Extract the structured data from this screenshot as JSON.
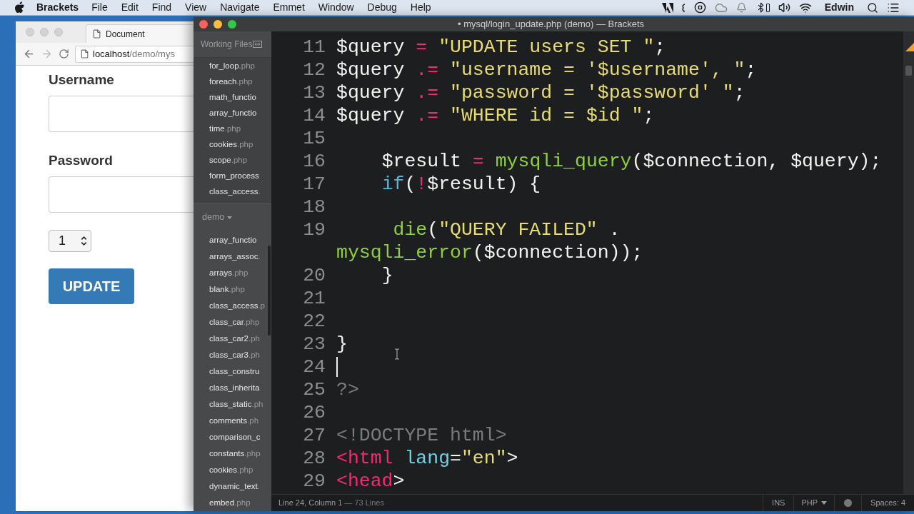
{
  "menubar": {
    "app": "Brackets",
    "menus": [
      "File",
      "Edit",
      "Find",
      "View",
      "Navigate",
      "Emmet",
      "Window",
      "Debug",
      "Help"
    ],
    "user": "Edwin"
  },
  "browser": {
    "tab": "Document",
    "url_host": "localhost",
    "url_path": "/demo/mys",
    "fields": [
      {
        "label": "Username"
      },
      {
        "label": "Password"
      }
    ],
    "select": "1",
    "button": "UPDATE"
  },
  "editor": {
    "title": "• mysql/login_update.php (demo) — Brackets",
    "working_files_title": "Working Files",
    "working_files": [
      {
        "name": "for_loop",
        "ext": ".php"
      },
      {
        "name": "foreach",
        "ext": ".php"
      },
      {
        "name": "math_functio"
      },
      {
        "name": "array_functio"
      },
      {
        "name": "time",
        "ext": ".php"
      },
      {
        "name": "cookies",
        "ext": ".php"
      },
      {
        "name": "scope",
        "ext": ".php"
      },
      {
        "name": "form_process"
      },
      {
        "name": "class_access",
        "ext": "."
      }
    ],
    "project": "demo",
    "project_files": [
      {
        "name": "array_functio"
      },
      {
        "name": "arrays_assoc",
        "ext": "."
      },
      {
        "name": "arrays",
        "ext": ".php"
      },
      {
        "name": "blank",
        "ext": ".php"
      },
      {
        "name": "class_access",
        "ext": ".p"
      },
      {
        "name": "class_car",
        "ext": ".php"
      },
      {
        "name": "class_car2",
        "ext": ".ph"
      },
      {
        "name": "class_car3",
        "ext": ".ph"
      },
      {
        "name": "class_constru"
      },
      {
        "name": "class_inherita"
      },
      {
        "name": "class_static",
        "ext": ".ph"
      },
      {
        "name": "comments",
        "ext": ".ph"
      },
      {
        "name": "comparison_c"
      },
      {
        "name": "constants",
        "ext": ".php"
      },
      {
        "name": "cookies",
        "ext": ".php"
      },
      {
        "name": "dynamic_text",
        "ext": "."
      },
      {
        "name": "embed",
        "ext": ".php"
      }
    ],
    "lines": [
      {
        "number": "11",
        "cursor": false,
        "tokens": [
          {
            "t": "$query ",
            "color": "#f2f2ee"
          },
          {
            "t": "= ",
            "color": "#f92672"
          },
          {
            "t": "\"UPDATE users SET \"",
            "color": "#e6db74"
          },
          {
            "t": ";",
            "color": "#f2f2ee"
          }
        ]
      },
      {
        "number": "12",
        "cursor": false,
        "tokens": [
          {
            "t": "$query ",
            "color": "#f2f2ee"
          },
          {
            "t": ".= ",
            "color": "#f92672"
          },
          {
            "t": "\"username = '$username', \"",
            "color": "#e6db74"
          },
          {
            "t": ";",
            "color": "#f2f2ee"
          }
        ]
      },
      {
        "number": "13",
        "cursor": false,
        "tokens": [
          {
            "t": "$query ",
            "color": "#f2f2ee"
          },
          {
            "t": ".= ",
            "color": "#f92672"
          },
          {
            "t": "\"password = '$password' \"",
            "color": "#e6db74"
          },
          {
            "t": ";",
            "color": "#f2f2ee"
          }
        ]
      },
      {
        "number": "14",
        "cursor": false,
        "tokens": [
          {
            "t": "$query ",
            "color": "#f2f2ee"
          },
          {
            "t": ".= ",
            "color": "#f92672"
          },
          {
            "t": "\"WHERE id = $id \"",
            "color": "#e6db74"
          },
          {
            "t": ";",
            "color": "#f2f2ee"
          }
        ]
      },
      {
        "number": "15",
        "cursor": false
      },
      {
        "number": "16",
        "cursor": false,
        "tokens": [
          {
            "t": "    $result ",
            "color": "#f2f2ee"
          },
          {
            "t": "= ",
            "color": "#f92672"
          },
          {
            "t": "mysqli_query",
            "color": "#8fcf3c"
          },
          {
            "t": "($connection, $query);",
            "color": "#f2f2ee"
          }
        ]
      },
      {
        "number": "17",
        "cursor": false,
        "tokens": [
          {
            "t": "    if",
            "color": "#54b6d8"
          },
          {
            "t": "(",
            "color": "#f2f2ee"
          },
          {
            "t": "!",
            "color": "#f92672"
          },
          {
            "t": "$result) {",
            "color": "#f2f2ee"
          }
        ]
      },
      {
        "number": "18",
        "cursor": false
      },
      {
        "number": "19",
        "cursor": false,
        "tokens": [
          {
            "t": "     die",
            "color": "#8fcf3c"
          },
          {
            "t": "(",
            "color": "#f2f2ee"
          },
          {
            "t": "\"QUERY FAILED\"",
            "color": "#e6db74"
          },
          {
            "t": " . ",
            "color": "#f2f2ee"
          },
          {
            "t": "mysqli_error",
            "color": "#8fcf3c"
          },
          {
            "t": "($connection));",
            "color": "#f2f2ee"
          }
        ]
      },
      {
        "number": "20",
        "cursor": false,
        "tokens": [
          {
            "t": "    }",
            "color": "#f2f2ee"
          }
        ]
      },
      {
        "number": "21",
        "cursor": false
      },
      {
        "number": "22",
        "cursor": false
      },
      {
        "number": "23",
        "cursor": false,
        "tokens": [
          {
            "t": "}",
            "color": "#f2f2ee"
          }
        ]
      },
      {
        "number": "24",
        "cursor": true
      },
      {
        "number": "25",
        "cursor": false,
        "tokens": [
          {
            "t": "?>",
            "color": "#7b7b7b"
          }
        ]
      },
      {
        "number": "26",
        "cursor": false
      },
      {
        "number": "27",
        "cursor": false,
        "tokens": [
          {
            "t": "<!DOCTYPE html>",
            "color": "#7b7b7b"
          }
        ]
      },
      {
        "number": "28",
        "cursor": false,
        "tokens": [
          {
            "t": "<html ",
            "color": "#f92672"
          },
          {
            "t": "lang",
            "color": "#6fd3e8"
          },
          {
            "t": "=",
            "color": "#f2f2ee"
          },
          {
            "t": "\"en\"",
            "color": "#e6db74"
          },
          {
            "t": ">",
            "color": "#f2f2ee"
          }
        ]
      },
      {
        "number": "29",
        "cursor": false,
        "tokens": [
          {
            "t": "<head",
            "color": "#f92672"
          },
          {
            "t": ">",
            "color": "#f2f2ee"
          }
        ]
      }
    ]
  },
  "status_bar": {
    "position": "Line 24, Column 1",
    "line_count": "— 73 Lines",
    "mode": "INS",
    "language": "PHP",
    "spaces": "Spaces: 4"
  }
}
